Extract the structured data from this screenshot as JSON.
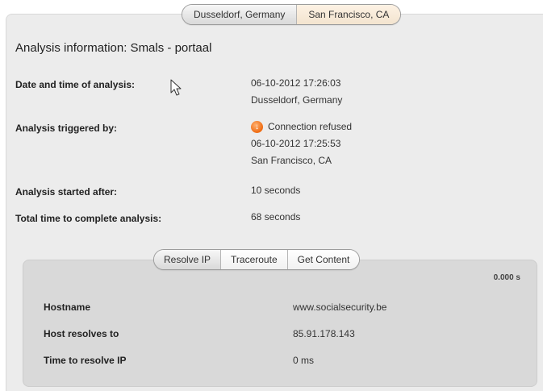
{
  "location_tabs": [
    {
      "label": "Dusseldorf, Germany",
      "active": true
    },
    {
      "label": "San Francisco, CA",
      "active": false
    }
  ],
  "title": "Analysis information: Smals - portaal",
  "info": {
    "date_label": "Date and time of analysis:",
    "date_value": "06-10-2012 17:26:03",
    "date_location": "Dusseldorf, Germany",
    "triggered_label": "Analysis triggered by:",
    "triggered_status": "Connection refused",
    "triggered_time": "06-10-2012 17:25:53",
    "triggered_location": "San Francisco, CA",
    "started_label": "Analysis started after:",
    "started_value": "10 seconds",
    "total_label": "Total time to complete analysis:",
    "total_value": "68 seconds"
  },
  "detail_tabs": [
    {
      "label": "Resolve IP",
      "active": true
    },
    {
      "label": "Traceroute",
      "active": false
    },
    {
      "label": "Get Content",
      "active": false
    }
  ],
  "resolve": {
    "timing": "0.000 s",
    "hostname_label": "Hostname",
    "hostname_value": "www.socialsecurity.be",
    "resolves_label": "Host resolves to",
    "resolves_value": "85.91.178.143",
    "time_label": "Time to resolve IP",
    "time_value": "0 ms"
  },
  "colors": {
    "panel_bg": "#ececec",
    "inner_bg": "#d9d9d9",
    "status_icon": "#ee6a10"
  },
  "icons": {
    "status": "arrow-down-circle-icon",
    "cursor": "mouse-pointer-icon"
  }
}
